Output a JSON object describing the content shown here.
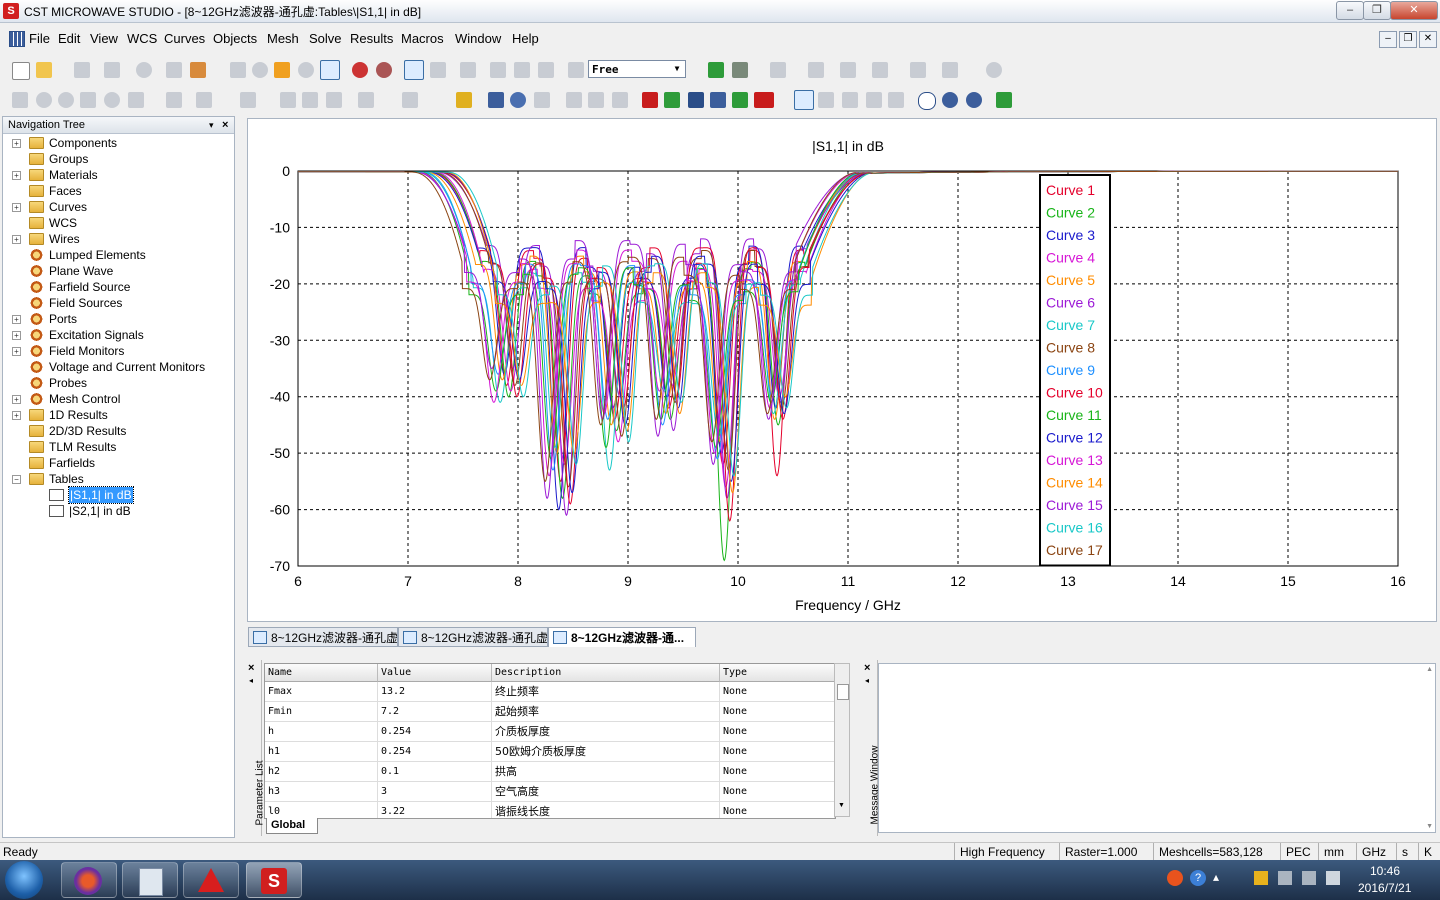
{
  "window": {
    "title": "CST MICROWAVE STUDIO - [8~12GHz滤波器-通孔虚:Tables\\|S1,1| in dB]",
    "app_icon_glyph": "S"
  },
  "menu": [
    "File",
    "Edit",
    "View",
    "WCS",
    "Curves",
    "Objects",
    "Mesh",
    "Solve",
    "Results",
    "Macros",
    "Window",
    "Help"
  ],
  "toolbar": {
    "mesh_view_select": "Free"
  },
  "nav_tree": {
    "header": "Navigation Tree",
    "items": [
      {
        "label": "Components",
        "exp": "+",
        "icon": "folder"
      },
      {
        "label": "Groups",
        "exp": "",
        "icon": "folder"
      },
      {
        "label": "Materials",
        "exp": "+",
        "icon": "folder"
      },
      {
        "label": "Faces",
        "exp": "",
        "icon": "folder"
      },
      {
        "label": "Curves",
        "exp": "+",
        "icon": "folder"
      },
      {
        "label": "WCS",
        "exp": "",
        "icon": "folder"
      },
      {
        "label": "Wires",
        "exp": "+",
        "icon": "folder"
      },
      {
        "label": "Lumped Elements",
        "exp": "",
        "icon": "gear"
      },
      {
        "label": "Plane Wave",
        "exp": "",
        "icon": "gear"
      },
      {
        "label": "Farfield Source",
        "exp": "",
        "icon": "gear"
      },
      {
        "label": "Field Sources",
        "exp": "",
        "icon": "gear"
      },
      {
        "label": "Ports",
        "exp": "+",
        "icon": "gear"
      },
      {
        "label": "Excitation Signals",
        "exp": "+",
        "icon": "gear"
      },
      {
        "label": "Field Monitors",
        "exp": "+",
        "icon": "gear"
      },
      {
        "label": "Voltage and Current Monitors",
        "exp": "",
        "icon": "gear"
      },
      {
        "label": "Probes",
        "exp": "",
        "icon": "gear"
      },
      {
        "label": "Mesh Control",
        "exp": "+",
        "icon": "gear"
      },
      {
        "label": "1D Results",
        "exp": "+",
        "icon": "folder"
      },
      {
        "label": "2D/3D Results",
        "exp": "",
        "icon": "folder"
      },
      {
        "label": "TLM Results",
        "exp": "",
        "icon": "folder"
      },
      {
        "label": "Farfields",
        "exp": "",
        "icon": "folder"
      },
      {
        "label": "Tables",
        "exp": "−",
        "icon": "folder"
      }
    ],
    "table_children": [
      "|S1,1| in dB",
      "|S2,1| in dB"
    ]
  },
  "chart_data": {
    "type": "line",
    "title": "|S1,1| in dB",
    "xlabel": "Frequency / GHz",
    "ylabel": "",
    "xlim": [
      6,
      16
    ],
    "ylim": [
      -70,
      0
    ],
    "xticks": [
      6,
      7,
      8,
      9,
      10,
      11,
      12,
      13,
      14,
      15,
      16
    ],
    "yticks": [
      0,
      -10,
      -20,
      -30,
      -40,
      -50,
      -60,
      -70
    ],
    "grid": true,
    "legend_placement": "top-right",
    "series": [
      {
        "name": "Curve 1",
        "color": "#e4002b",
        "shift": 0.0,
        "peak": -15,
        "dips": [
          -38,
          -55,
          -44,
          -42,
          -52,
          -54
        ]
      },
      {
        "name": "Curve 2",
        "color": "#19b419",
        "shift": 0.02,
        "peak": -17,
        "dips": [
          -40,
          -58,
          -46,
          -44,
          -69,
          -45
        ]
      },
      {
        "name": "Curve 3",
        "color": "#1a1acc",
        "shift": -0.02,
        "peak": -14,
        "dips": [
          -36,
          -60,
          -42,
          -40,
          -50,
          -42
        ]
      },
      {
        "name": "Curve 4",
        "color": "#d616d6",
        "shift": 0.04,
        "peak": -18,
        "dips": [
          -39,
          -52,
          -48,
          -38,
          -56,
          -40
        ]
      },
      {
        "name": "Curve 5",
        "color": "#ff8c00",
        "shift": -0.04,
        "peak": -16,
        "dips": [
          -37,
          -50,
          -45,
          -43,
          -48,
          -44
        ]
      },
      {
        "name": "Curve 6",
        "color": "#9c1ad6",
        "shift": 0.06,
        "peak": -13,
        "dips": [
          -35,
          -61,
          -40,
          -46,
          -58,
          -41
        ]
      },
      {
        "name": "Curve 7",
        "color": "#19c8c8",
        "shift": -0.06,
        "peak": -19,
        "dips": [
          -41,
          -49,
          -53,
          -39,
          -47,
          -43
        ]
      },
      {
        "name": "Curve 8",
        "color": "#8b4513",
        "shift": 0.08,
        "peak": -15,
        "dips": [
          -38,
          -56,
          -47,
          -41,
          -53,
          -42
        ]
      },
      {
        "name": "Curve 9",
        "color": "#1e90ff",
        "shift": -0.08,
        "peak": -17,
        "dips": [
          -36,
          -53,
          -44,
          -45,
          -51,
          -40
        ]
      },
      {
        "name": "Curve 10",
        "color": "#e4002b",
        "shift": 0.1,
        "peak": -14,
        "dips": [
          -40,
          -59,
          -42,
          -40,
          -62,
          -44
        ]
      },
      {
        "name": "Curve 11",
        "color": "#19b419",
        "shift": -0.1,
        "peak": -18,
        "dips": [
          -39,
          -51,
          -49,
          -44,
          -49,
          -41
        ]
      },
      {
        "name": "Curve 12",
        "color": "#1a1acc",
        "shift": 0.12,
        "peak": -16,
        "dips": [
          -37,
          -57,
          -45,
          -42,
          -55,
          -43
        ]
      },
      {
        "name": "Curve 13",
        "color": "#d616d6",
        "shift": -0.12,
        "peak": -15,
        "dips": [
          -41,
          -54,
          -43,
          -39,
          -50,
          -42
        ]
      },
      {
        "name": "Curve 14",
        "color": "#ff8c00",
        "shift": 0.14,
        "peak": -19,
        "dips": [
          -38,
          -50,
          -46,
          -43,
          -57,
          -40
        ]
      },
      {
        "name": "Curve 15",
        "color": "#9c1ad6",
        "shift": -0.14,
        "peak": -13,
        "dips": [
          -35,
          -58,
          -44,
          -47,
          -52,
          -44
        ]
      },
      {
        "name": "Curve 16",
        "color": "#19c8c8",
        "shift": 0.16,
        "peak": -17,
        "dips": [
          -40,
          -52,
          -48,
          -41,
          -54,
          -42
        ]
      },
      {
        "name": "Curve 17",
        "color": "#8b4513",
        "shift": -0.16,
        "peak": -16,
        "dips": [
          -37,
          -55,
          -45,
          -44,
          -48,
          -43
        ]
      }
    ]
  },
  "doc_tabs": [
    {
      "label": "8~12GHz滤波器-通孔虚",
      "active": false
    },
    {
      "label": "8~12GHz滤波器-通孔虚",
      "active": false
    },
    {
      "label": "8~12GHz滤波器-通...",
      "active": true
    }
  ],
  "param_list": {
    "side_label": "Parameter List",
    "columns": [
      "Name",
      "Value",
      "Description",
      "Type"
    ],
    "rows": [
      [
        "Fmax",
        "13.2",
        "终止频率",
        "None"
      ],
      [
        "Fmin",
        "7.2",
        "起始频率",
        "None"
      ],
      [
        "h",
        "0.254",
        "介质板厚度",
        "None"
      ],
      [
        "h1",
        "0.254",
        "50欧姆介质板厚度",
        "None"
      ],
      [
        "h2",
        "0.1",
        "拱高",
        "None"
      ],
      [
        "h3",
        "3",
        "空气高度",
        "None"
      ],
      [
        "l0",
        "3.22",
        "谐振线长度",
        "None"
      ]
    ],
    "tab": "Global"
  },
  "message_window": {
    "side_label": "Message Window"
  },
  "status": {
    "left": "Ready",
    "items": [
      "High Frequency",
      "Raster=1.000",
      "Meshcells=583,128",
      "PEC",
      "mm",
      "GHz",
      "s",
      "K"
    ]
  },
  "taskbar": {
    "time": "10:46",
    "date": "2016/7/21"
  }
}
